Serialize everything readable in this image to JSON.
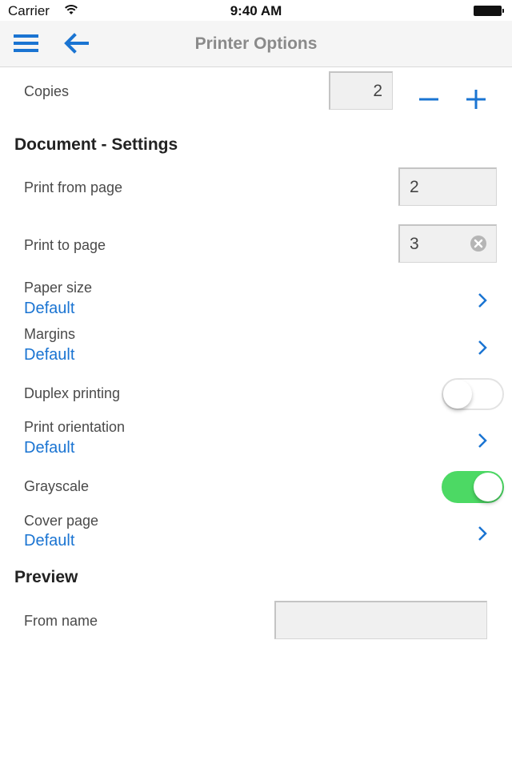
{
  "status_bar": {
    "carrier": "Carrier",
    "time": "9:40 AM"
  },
  "nav": {
    "title": "Printer Options",
    "menu_icon": "hamburger-menu-icon",
    "back_icon": "arrow-left-icon"
  },
  "copies": {
    "label": "Copies",
    "value": "2",
    "decrement_icon": "minus-icon",
    "increment_icon": "plus-icon"
  },
  "document_settings": {
    "title": "Document - Settings",
    "print_from_page": {
      "label": "Print from page",
      "value": "2"
    },
    "print_to_page": {
      "label": "Print to page",
      "value": "3",
      "clear_icon": "clear-circle-icon"
    },
    "paper_size": {
      "label": "Paper size",
      "value": "Default"
    },
    "margins": {
      "label": "Margins",
      "value": "Default"
    },
    "duplex_printing": {
      "label": "Duplex printing",
      "enabled": false
    },
    "print_orientation": {
      "label": "Print orientation",
      "value": "Default"
    },
    "grayscale": {
      "label": "Grayscale",
      "enabled": true
    },
    "cover_page": {
      "label": "Cover page",
      "value": "Default"
    }
  },
  "preview": {
    "title": "Preview",
    "from_name": {
      "label": "From name",
      "value": ""
    }
  },
  "colors": {
    "accent": "#1a74d2",
    "toggle_on": "#4cd964",
    "nav_background": "#f5f5f5",
    "title_gray": "#8a8a8a"
  }
}
